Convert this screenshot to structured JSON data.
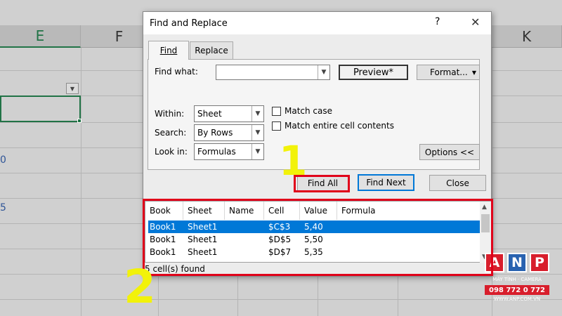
{
  "spreadsheet": {
    "column_headers": [
      "E",
      "F",
      "K"
    ],
    "edge_chars": [
      "0",
      "5"
    ]
  },
  "dialog": {
    "title": "Find and Replace",
    "help_label": "?",
    "close_label": "✕",
    "tabs": [
      {
        "label": "Find",
        "active": true
      },
      {
        "label": "Replace",
        "active": false
      }
    ],
    "find_what_label": "Find what:",
    "find_what_value": "",
    "preview_label": "Preview*",
    "format_label": "Format...",
    "within_label": "Within:",
    "within_value": "Sheet",
    "search_label": "Search:",
    "search_value": "By Rows",
    "look_in_label": "Look in:",
    "look_in_value": "Formulas",
    "match_case_label": "Match case",
    "match_entire_label": "Match entire cell contents",
    "options_label": "Options <<",
    "find_all_label": "Find All",
    "find_next_label": "Find Next",
    "close_button_label": "Close"
  },
  "results": {
    "columns": [
      "Book",
      "Sheet",
      "Name",
      "Cell",
      "Value",
      "Formula"
    ],
    "rows": [
      {
        "book": "Book1",
        "sheet": "Sheet1",
        "name": "",
        "cell": "$C$3",
        "value": "5,40",
        "formula": "",
        "selected": true
      },
      {
        "book": "Book1",
        "sheet": "Sheet1",
        "name": "",
        "cell": "$D$5",
        "value": "5,50",
        "formula": "",
        "selected": false
      },
      {
        "book": "Book1",
        "sheet": "Sheet1",
        "name": "",
        "cell": "$D$7",
        "value": "5,35",
        "formula": "",
        "selected": false
      }
    ],
    "status": "5 cell(s) found"
  },
  "annotations": {
    "marker_1": "1",
    "marker_2": "2",
    "color": "#e0001a",
    "marker_color": "#f2f20a"
  },
  "logo": {
    "letters": [
      "A",
      "N",
      "P"
    ],
    "tagline": "MÁY TÍNH · CAMERA",
    "phone": "098 772 0 772",
    "website": "WWW.ANP.COM.VN"
  },
  "colors": {
    "accent_green": "#217346",
    "selection_blue": "#0078d7"
  }
}
